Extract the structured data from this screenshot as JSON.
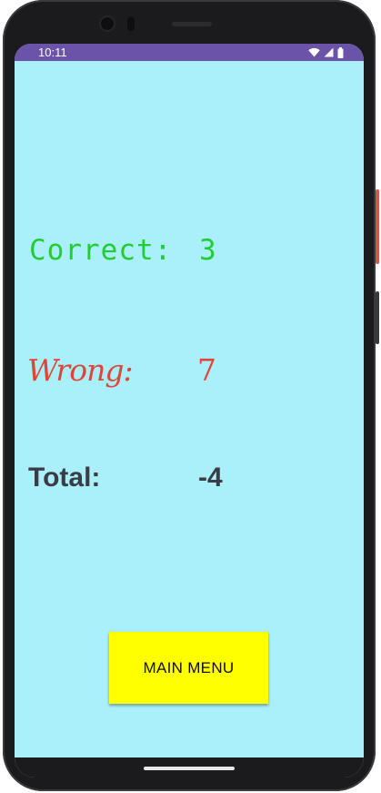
{
  "status_bar": {
    "time": "10:11",
    "icons": [
      "wifi-icon",
      "cellular-signal-icon",
      "battery-icon"
    ],
    "color": "#6a53a8"
  },
  "screen": {
    "background": "#aaf0fa"
  },
  "results": {
    "correct": {
      "label": "Correct:",
      "value": "3",
      "color": "#22cc33"
    },
    "wrong": {
      "label": "Wrong:",
      "value": "7",
      "color": "#e0453a"
    },
    "total": {
      "label": "Total:",
      "value": "-4",
      "color": "#3c3c46"
    }
  },
  "main_menu_button": {
    "label": "MAIN MENU",
    "color": "#ffff00"
  }
}
